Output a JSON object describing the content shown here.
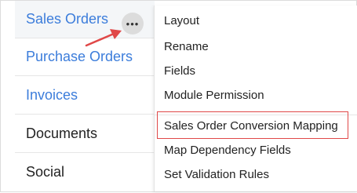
{
  "sidebar": {
    "items": [
      {
        "label": "Sales Orders",
        "style": "link",
        "active": true
      },
      {
        "label": "Purchase Orders",
        "style": "link",
        "active": false
      },
      {
        "label": "Invoices",
        "style": "link",
        "active": false
      },
      {
        "label": "Documents",
        "style": "plain",
        "active": false
      },
      {
        "label": "Social",
        "style": "plain",
        "active": false
      }
    ],
    "more_button_glyph": "•••"
  },
  "menu": {
    "items": [
      {
        "label": "Layout"
      },
      {
        "label": "Rename"
      },
      {
        "label": "Fields"
      },
      {
        "label": "Module Permission"
      },
      {
        "label": "Sales Order Conversion Mapping",
        "highlighted": true
      },
      {
        "label": "Map Dependency Fields"
      },
      {
        "label": "Set Validation Rules"
      }
    ]
  },
  "colors": {
    "link": "#3c7ddb",
    "text": "#222222",
    "annotation": "#e04848"
  }
}
